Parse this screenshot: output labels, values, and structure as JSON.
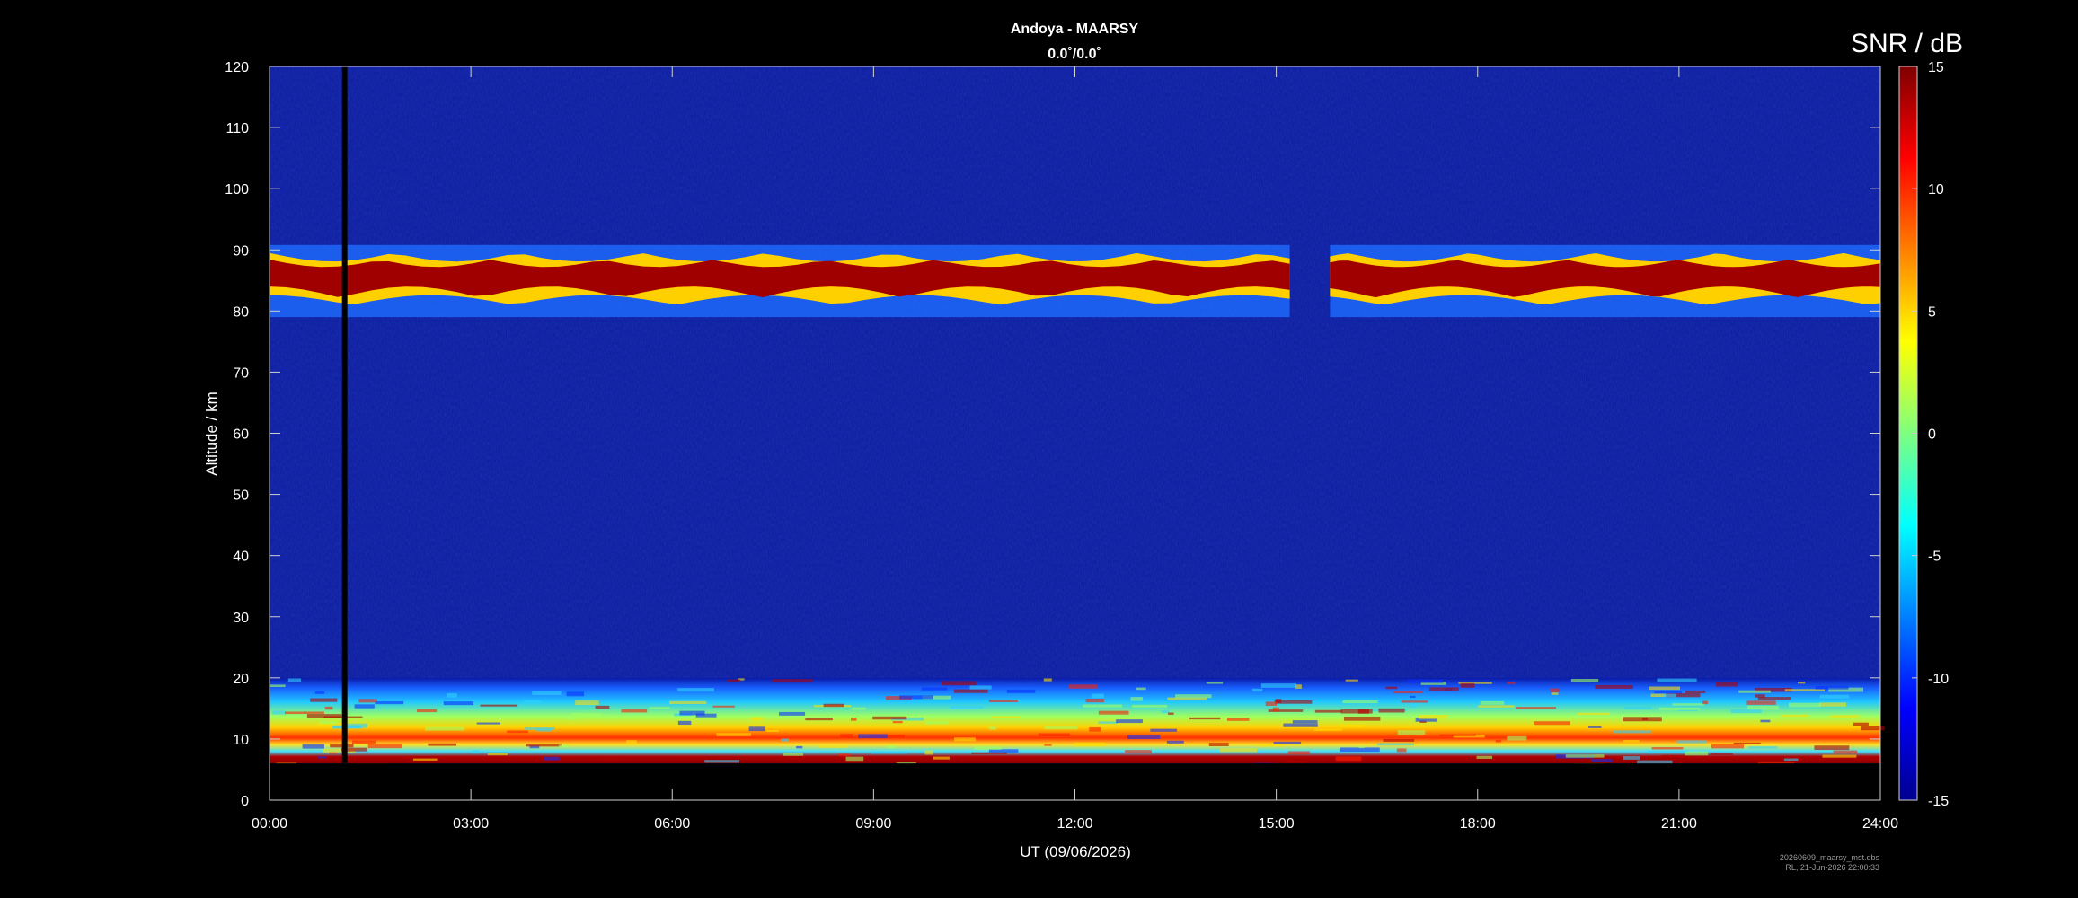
{
  "chart_data": {
    "type": "heatmap",
    "title": "Andoya - MAARSY",
    "subtitle": "0.0˚/0.0˚",
    "xlabel": "UT (09/06/2026)",
    "ylabel": "Altitude / km",
    "x_ticks": [
      "00:00",
      "03:00",
      "06:00",
      "09:00",
      "12:00",
      "15:00",
      "18:00",
      "21:00",
      "24:00"
    ],
    "xlim_hours": [
      0,
      24
    ],
    "y_ticks": [
      0,
      10,
      20,
      30,
      40,
      50,
      60,
      70,
      80,
      90,
      100,
      110,
      120
    ],
    "ylim": [
      0,
      120
    ],
    "colorbar": {
      "label": "SNR / dB",
      "range": [
        -15,
        15
      ],
      "ticks": [
        -15,
        -10,
        -5,
        0,
        5,
        10,
        15
      ],
      "colormap": "jet"
    },
    "features": [
      {
        "name": "PMSE layer",
        "altitude_km": [
          80,
          90
        ],
        "time_hours": [
          0,
          24
        ],
        "snr_db": 15,
        "gap_hours": [
          15.2,
          15.8
        ]
      },
      {
        "name": "Lower atmosphere echoes",
        "altitude_km": [
          6,
          20
        ],
        "time_hours": [
          0,
          24
        ],
        "snr_db": 10
      },
      {
        "name": "Data gap",
        "time_hours": [
          1.08,
          1.16
        ],
        "altitude_km": [
          6,
          120
        ]
      }
    ],
    "background_snr_db": -13,
    "no_data_below_km": 6
  },
  "footer": {
    "line1": "20260609_maarsy_mst.dbs",
    "line2": "RL, 21-Jun-2026 22:00:33"
  }
}
